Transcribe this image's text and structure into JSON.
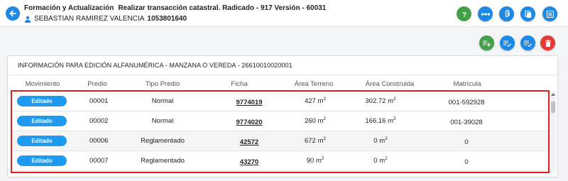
{
  "header": {
    "breadcrumb_module": "Formación y Actualización",
    "breadcrumb_task": "Realizar transacción catastral. Radicado - 917 Versión - 60031",
    "user_name": "SEBASTIAN RAMIREZ VALENCIA",
    "user_id": "1053801640",
    "back_icon": "arrow-left-icon",
    "user_icon": "person-icon"
  },
  "toolbar": {
    "buttons": [
      {
        "icon": "help-icon",
        "color": "#43a047"
      },
      {
        "icon": "more-dots-icon",
        "color": "#1e88e5"
      },
      {
        "icon": "attachment-icon",
        "color": "#1e88e5"
      },
      {
        "icon": "documents-icon",
        "color": "#1e88e5"
      },
      {
        "icon": "list-icon",
        "color": "#1e88e5"
      }
    ]
  },
  "actions": {
    "buttons": [
      {
        "icon": "add-list-icon",
        "color": "#43a047"
      },
      {
        "icon": "checklist-icon",
        "color": "#1e88e5"
      },
      {
        "icon": "checklist-icon",
        "color": "#1e88e5"
      },
      {
        "icon": "delete-icon",
        "color": "#e53935"
      }
    ]
  },
  "panel": {
    "title": "INFORMACIÓN PARA EDICIÓN ALFANUMÉRICA - MANZANA O VEREDA - 26610010020001"
  },
  "table": {
    "columns": {
      "movimiento": "Movimiento",
      "predio": "Predio",
      "tipo_predio": "Tipo Predio",
      "ficha": "Ficha",
      "area_terreno": "Área Terreno",
      "area_construida": "Área Construida",
      "matricula": "Matrícula"
    },
    "area_unit": "m",
    "area_unit_exp": "2",
    "rows": [
      {
        "movimiento": "Editado",
        "predio": "00001",
        "tipo_predio": "Normal",
        "ficha": "9774019",
        "area_terreno": "427",
        "area_construida": "302.72",
        "matricula": "001-592928"
      },
      {
        "movimiento": "Editado",
        "predio": "00002",
        "tipo_predio": "Normal",
        "ficha": "9774020",
        "area_terreno": "260",
        "area_construida": "166.16",
        "matricula": "001-39028"
      },
      {
        "movimiento": "Editado",
        "predio": "00006",
        "tipo_predio": "Reglamentado",
        "ficha": "42572",
        "area_terreno": "672",
        "area_construida": "0",
        "matricula": "0"
      },
      {
        "movimiento": "Editado",
        "predio": "00007",
        "tipo_predio": "Reglamentado",
        "ficha": "43270",
        "area_terreno": "90",
        "area_construida": "0",
        "matricula": "0"
      }
    ]
  },
  "colors": {
    "primary": "#1e88e5",
    "success": "#43a047",
    "danger": "#e53935",
    "highlight_border": "#e02020",
    "movement_badge": "#1e9bf0"
  }
}
